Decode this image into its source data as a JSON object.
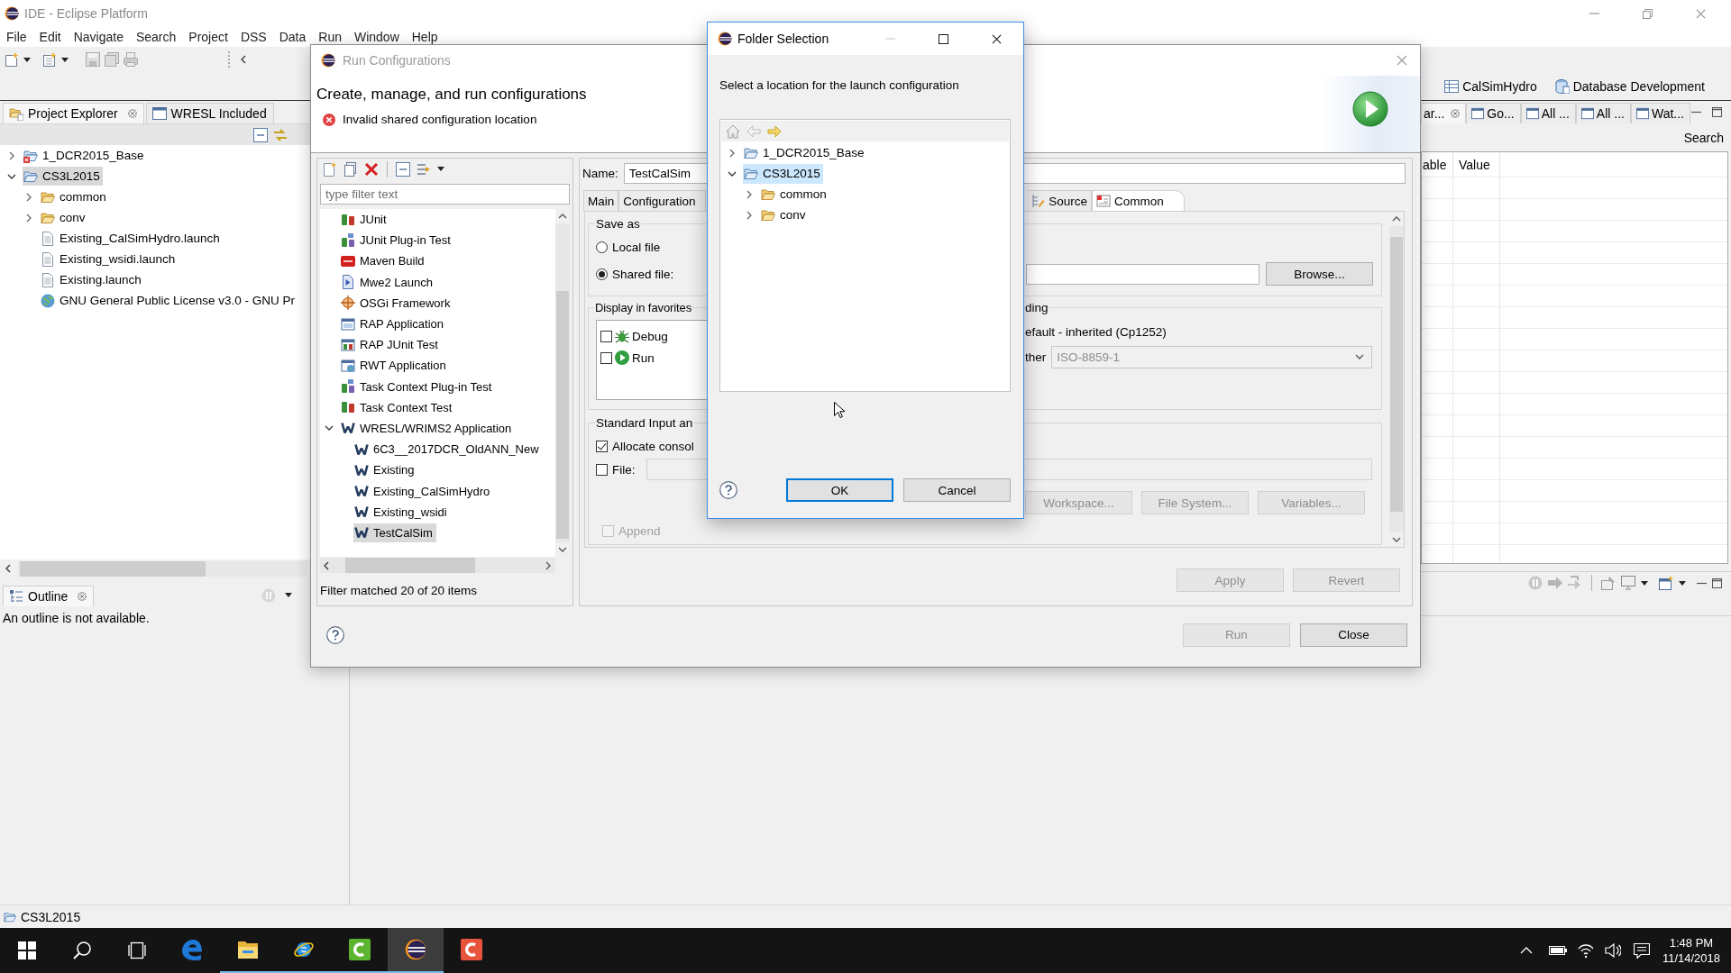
{
  "window": {
    "title": "IDE - Eclipse Platform"
  },
  "menu_bar": [
    "File",
    "Edit",
    "Navigate",
    "Search",
    "Project",
    "DSS",
    "Data",
    "Run",
    "Window",
    "Help"
  ],
  "perspectives": [
    {
      "label": "CalSimHydro",
      "kind": "table"
    },
    {
      "label": "Database Development",
      "kind": "database"
    }
  ],
  "project_explorer": {
    "tabs": [
      {
        "label": "Project Explorer",
        "selected": true
      },
      {
        "label": "WRESL Included",
        "selected": false
      }
    ],
    "tree": [
      {
        "label": "1_DCR2015_Base",
        "kind": "project-error",
        "expanded": false,
        "selected": false
      },
      {
        "label": "CS3L2015",
        "kind": "project",
        "expanded": true,
        "selected": true,
        "children": [
          {
            "label": "common",
            "kind": "folder",
            "expanded": false,
            "selected": false
          },
          {
            "label": "conv",
            "kind": "folder",
            "expanded": false,
            "selected": false
          },
          {
            "label": "Existing_CalSimHydro.launch",
            "kind": "file",
            "selected": false
          },
          {
            "label": "Existing_wsidi.launch",
            "kind": "file",
            "selected": false
          },
          {
            "label": "Existing.launch",
            "kind": "file",
            "selected": false
          },
          {
            "label": "GNU General Public License v3.0 - GNU Pr",
            "kind": "link",
            "selected": false
          }
        ]
      }
    ]
  },
  "outline": {
    "tab": "Outline",
    "message": "An outline is not available."
  },
  "right_views": {
    "tabs": [
      {
        "label": "ar...",
        "selected": true
      },
      {
        "label": "Go...",
        "selected": false
      },
      {
        "label": "All ...",
        "selected": false
      },
      {
        "label": "All ...",
        "selected": false
      },
      {
        "label": "Wat...",
        "selected": false
      }
    ],
    "search_label": "Search",
    "columns": [
      "able",
      "Value"
    ]
  },
  "status_bar": {
    "text": "CS3L2015"
  },
  "run_configurations": {
    "title": "Run Configurations",
    "heading": "Create, manage, and run configurations",
    "error": "Invalid shared configuration location",
    "filter": {
      "placeholder": "type filter text"
    },
    "types": [
      {
        "label": "JUnit",
        "kind": "junit",
        "selected": false
      },
      {
        "label": "JUnit Plug-in Test",
        "kind": "junit-plugin",
        "selected": false
      },
      {
        "label": "Maven Build",
        "kind": "maven",
        "selected": false
      },
      {
        "label": "Mwe2 Launch",
        "kind": "mwe2",
        "selected": false
      },
      {
        "label": "OSGi Framework",
        "kind": "osgi",
        "selected": false
      },
      {
        "label": "RAP Application",
        "kind": "rap",
        "selected": false
      },
      {
        "label": "RAP JUnit Test",
        "kind": "rap-junit",
        "selected": false
      },
      {
        "label": "RWT Application",
        "kind": "rwt",
        "selected": false
      },
      {
        "label": "Task Context Plug-in Test",
        "kind": "junit-plugin",
        "selected": false
      },
      {
        "label": "Task Context Test",
        "kind": "junit",
        "selected": false
      },
      {
        "label": "WRESL/WRIMS2 Application",
        "kind": "wresl",
        "expanded": true,
        "selected": false,
        "children": [
          {
            "label": "6C3__2017DCR_OldANN_New",
            "kind": "wresl",
            "selected": false
          },
          {
            "label": "Existing",
            "kind": "wresl",
            "selected": false
          },
          {
            "label": "Existing_CalSimHydro",
            "kind": "wresl",
            "selected": false
          },
          {
            "label": "Existing_wsidi",
            "kind": "wresl",
            "selected": false
          },
          {
            "label": "TestCalSim",
            "kind": "wresl",
            "selected": true
          }
        ]
      }
    ],
    "filter_status": "Filter matched 20 of 20 items",
    "name": {
      "label": "Name:",
      "value": "TestCalSim"
    },
    "tabs": [
      {
        "label": "Main",
        "kind": "plain",
        "selected": false
      },
      {
        "label": "Configuration",
        "kind": "plain",
        "selected": false
      },
      {
        "label": "Source",
        "kind": "source",
        "selected": false
      },
      {
        "label": "Common",
        "kind": "common",
        "selected": true
      }
    ],
    "save_as": {
      "legend": "Save as",
      "options": [
        {
          "label": "Local file",
          "selected": false
        },
        {
          "label": "Shared file:",
          "selected": true
        }
      ],
      "browse": "Browse..."
    },
    "favorites": {
      "legend": "Display in favorites",
      "items": [
        {
          "label": "Debug",
          "kind": "debug",
          "checked": false
        },
        {
          "label": "Run",
          "kind": "run",
          "checked": false
        }
      ]
    },
    "encoding": {
      "legend": "ding",
      "default_label": "efault - inherited (Cp1252)",
      "other_label": "ther",
      "other_value": "ISO-8859-1",
      "disabled": true
    },
    "standard_io": {
      "legend": "Standard Input an",
      "allocate": {
        "label": "Allocate consol",
        "checked": true
      },
      "file": {
        "label": "File:",
        "checked": false
      },
      "buttons": [
        {
          "label": "Workspace...",
          "disabled": true
        },
        {
          "label": "File System...",
          "disabled": true
        },
        {
          "label": "Variables...",
          "disabled": true
        }
      ],
      "append": {
        "label": "Append",
        "checked": false,
        "disabled": true
      }
    },
    "apply_buttons": [
      {
        "label": "Apply",
        "disabled": true
      },
      {
        "label": "Revert",
        "disabled": true
      }
    ],
    "dialog_buttons": [
      {
        "label": "Run",
        "disabled": true
      },
      {
        "label": "Close",
        "disabled": false
      }
    ]
  },
  "folder_selection": {
    "title": "Folder Selection",
    "message": "Select a location for the launch configuration",
    "tree": [
      {
        "label": "1_DCR2015_Base",
        "kind": "project",
        "expanded": false,
        "selected": false
      },
      {
        "label": "CS3L2015",
        "kind": "project",
        "expanded": true,
        "selected": true,
        "children": [
          {
            "label": "common",
            "kind": "folder",
            "expanded": false,
            "selected": false
          },
          {
            "label": "conv",
            "kind": "folder",
            "expanded": false,
            "selected": false
          }
        ]
      }
    ],
    "buttons": [
      {
        "label": "OK",
        "default": true
      },
      {
        "label": "Cancel",
        "default": false
      }
    ]
  },
  "taskbar": {
    "apps": [
      {
        "kind": "edge",
        "running": false,
        "selected": false
      },
      {
        "kind": "files",
        "running": true,
        "selected": false
      },
      {
        "kind": "ie",
        "running": true,
        "selected": false
      },
      {
        "kind": "recorder",
        "running": true,
        "selected": false
      },
      {
        "kind": "eclipse",
        "running": true,
        "selected": true
      },
      {
        "kind": "editor",
        "running": false,
        "selected": false
      }
    ],
    "time": "1:48 PM",
    "date": "11/14/2018"
  }
}
